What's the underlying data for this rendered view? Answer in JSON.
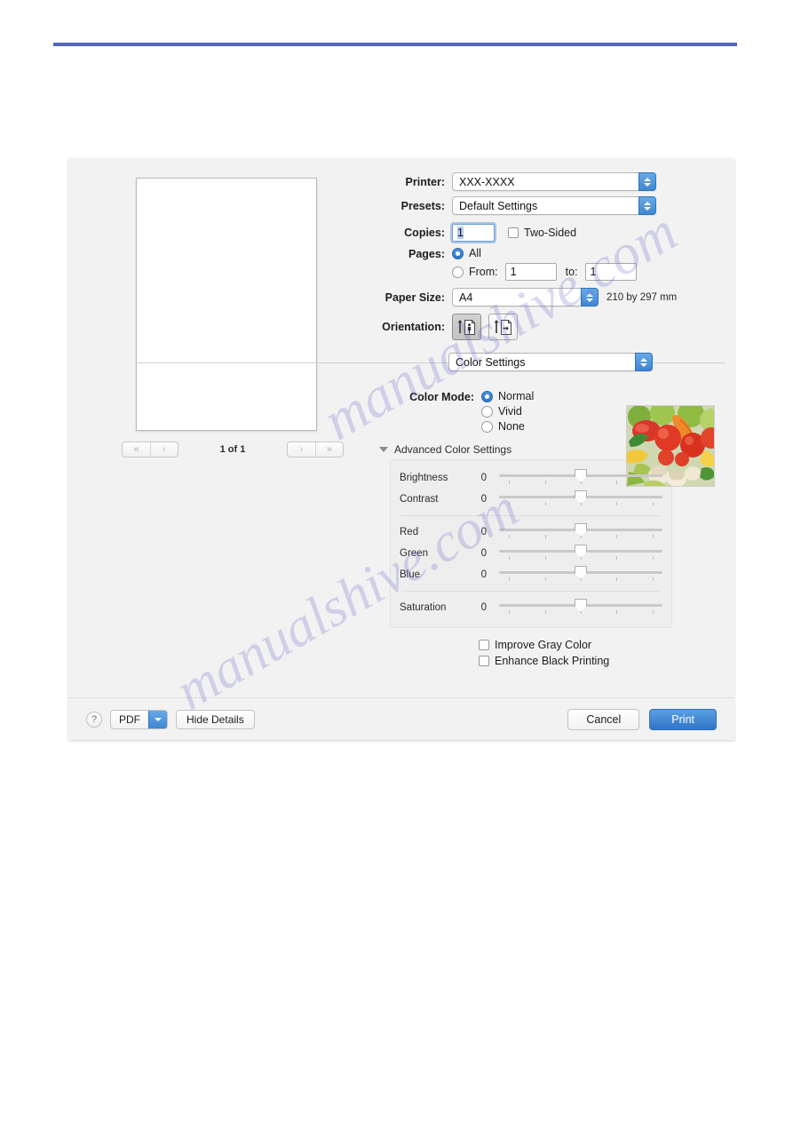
{
  "document": {
    "rule_color": "#5566bb"
  },
  "watermark": {
    "line1": "manualshive.com",
    "line2": "manualshive.com"
  },
  "dialog": {
    "preview": {
      "pager": {
        "first_label": "«",
        "prev_label": "‹",
        "page_label": "1 of 1",
        "next_label": "›",
        "last_label": "»"
      }
    },
    "printer": {
      "label": "Printer:",
      "value": "XXX-XXXX"
    },
    "presets": {
      "label": "Presets:",
      "value": "Default Settings"
    },
    "copies": {
      "label": "Copies:",
      "value": "1",
      "two_sided_label": "Two-Sided",
      "two_sided_checked": false
    },
    "pages": {
      "label": "Pages:",
      "all_label": "All",
      "all_selected": true,
      "from_label": "From:",
      "from_value": "1",
      "to_label": "to:",
      "to_value": "1"
    },
    "paper_size": {
      "label": "Paper Size:",
      "value": "A4",
      "dimensions": "210 by 297 mm"
    },
    "orientation": {
      "label": "Orientation:",
      "portrait_selected": true,
      "landscape_selected": false
    },
    "pane_popup": {
      "value": "Color Settings"
    },
    "color_mode": {
      "label": "Color Mode:",
      "options": [
        {
          "label": "Normal",
          "selected": true
        },
        {
          "label": "Vivid",
          "selected": false
        },
        {
          "label": "None",
          "selected": false
        }
      ]
    },
    "advanced": {
      "disclosure_label": "Advanced Color Settings",
      "expanded": true,
      "sliders": [
        {
          "name": "Brightness",
          "value": "0"
        },
        {
          "name": "Contrast",
          "value": "0"
        },
        {
          "name": "Red",
          "value": "0"
        },
        {
          "name": "Green",
          "value": "0"
        },
        {
          "name": "Blue",
          "value": "0"
        },
        {
          "name": "Saturation",
          "value": "0"
        }
      ],
      "checkboxes": [
        {
          "label": "Improve Gray Color",
          "checked": false
        },
        {
          "label": "Enhance Black Printing",
          "checked": false
        }
      ]
    },
    "footer": {
      "help_label": "?",
      "pdf_label": "PDF",
      "details_label": "Hide Details",
      "cancel_label": "Cancel",
      "print_label": "Print"
    }
  }
}
